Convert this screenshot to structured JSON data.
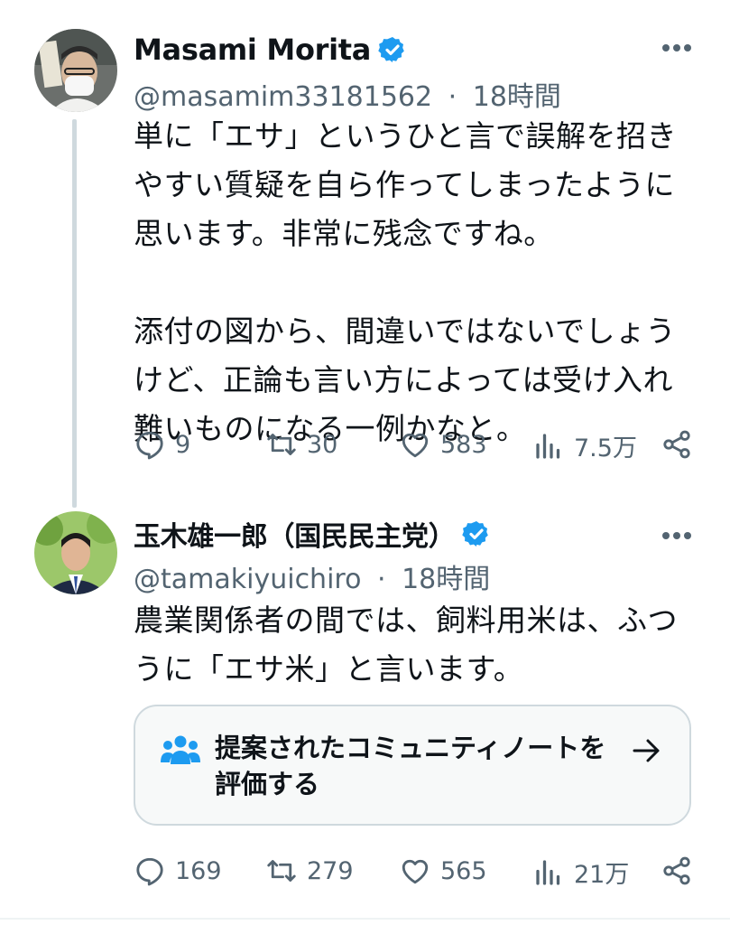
{
  "tweet1": {
    "name": "Masami Morita",
    "handle": "@masamim33181562",
    "separator": "·",
    "time": "18時間",
    "text": "単に「エサ」というひと言で誤解を招きやすい質疑を自ら作ってしまったように思います。非常に残念ですね。\n\n添付の図から、間違いではないでしょうけど、正論も言い方によっては受け入れ難いものになる一例かなと。",
    "replies": "9",
    "retweets": "30",
    "likes": "583",
    "views": "7.5万"
  },
  "tweet2": {
    "name": "玉木雄一郎（国民民主党）",
    "handle": "@tamakiyuichiro",
    "separator": "·",
    "time": "18時間",
    "text": "農業関係者の間では、飼料用米は、ふつうに「エサ米」と言います。",
    "community_note_prompt": "提案されたコミュニティノートを評価する",
    "replies": "169",
    "retweets": "279",
    "likes": "565",
    "views": "21万"
  },
  "colors": {
    "verified": "#1d9bf0",
    "text": "#0f1419",
    "muted": "#536471"
  },
  "icons": [
    "verified-badge-icon",
    "more-icon",
    "reply-icon",
    "retweet-icon",
    "like-icon",
    "views-icon",
    "share-icon",
    "community-notes-icon",
    "arrow-right-icon"
  ]
}
